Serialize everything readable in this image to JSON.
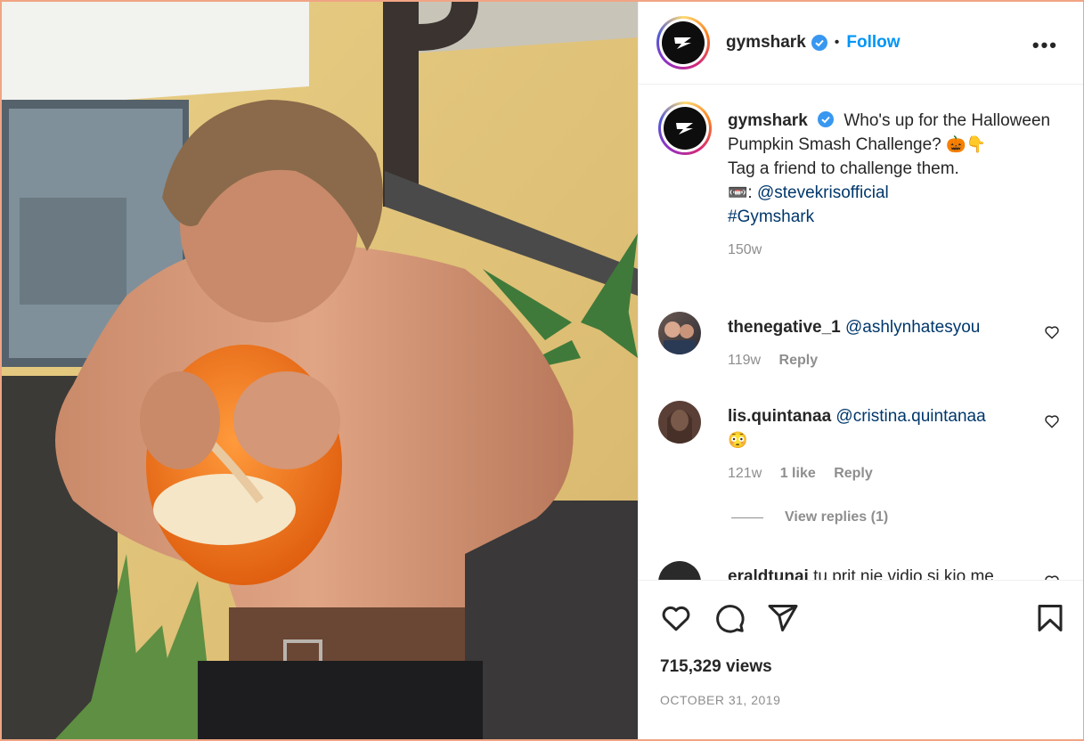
{
  "post": {
    "username": "gymshark",
    "follow_label": "Follow",
    "separator": "•",
    "more_label": "•••"
  },
  "caption": {
    "username": "gymshark",
    "line1": "Who's up for the Halloween Pumpkin Smash Challenge?",
    "emojis1": "🎃👇",
    "line2": "Tag a friend to challenge them.",
    "credit_icon": "📼",
    "credit_sep": ":",
    "credit_handle": "@stevekrisofficial",
    "hashtag": "#Gymshark",
    "time": "150w"
  },
  "comments": [
    {
      "username": "thenegative_1",
      "mention": "@ashlynhatesyou",
      "text": "",
      "time": "119w",
      "likes": "",
      "reply": "Reply"
    },
    {
      "username": "lis.quintanaa",
      "mention": "@cristina.quintanaa",
      "text": "😳",
      "time": "121w",
      "likes": "1 like",
      "reply": "Reply"
    },
    {
      "username": "eraldtunai",
      "mention": "",
      "text": "tu prit nje vidio si kjo me",
      "time": "",
      "likes": "",
      "reply": ""
    }
  ],
  "view_replies": "View replies (1)",
  "stats": {
    "views": "715,329 views",
    "date": "OCTOBER 31, 2019"
  },
  "icons": [
    "heart-icon",
    "comment-icon",
    "share-icon",
    "bookmark-icon",
    "verified-icon",
    "more-icon"
  ],
  "colors": {
    "accent": "#0095f6",
    "link": "#00376b",
    "muted": "#8e8e8e",
    "border": "#f0a484"
  }
}
